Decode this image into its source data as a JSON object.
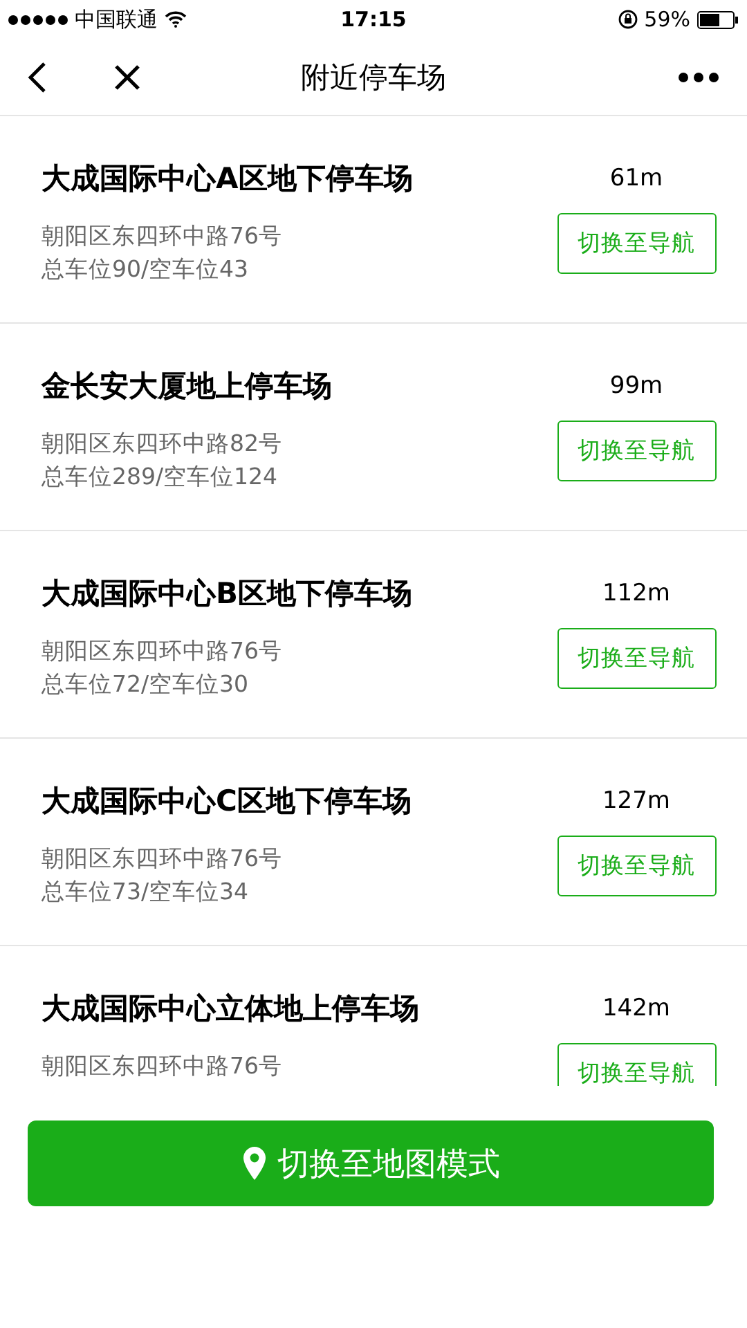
{
  "status_bar": {
    "carrier": "中国联通",
    "time": "17:15",
    "battery": "59%"
  },
  "nav": {
    "title": "附近停车场"
  },
  "parkings": [
    {
      "name": "大成国际中心A区地下停车场",
      "distance": "61m",
      "address": "朝阳区东四环中路76号",
      "spaces": "总车位90/空车位43",
      "button": "切换至导航"
    },
    {
      "name": "金长安大厦地上停车场",
      "distance": "99m",
      "address": "朝阳区东四环中路82号",
      "spaces": "总车位289/空车位124",
      "button": "切换至导航"
    },
    {
      "name": "大成国际中心B区地下停车场",
      "distance": "112m",
      "address": "朝阳区东四环中路76号",
      "spaces": "总车位72/空车位30",
      "button": "切换至导航"
    },
    {
      "name": "大成国际中心C区地下停车场",
      "distance": "127m",
      "address": "朝阳区东四环中路76号",
      "spaces": "总车位73/空车位34",
      "button": "切换至导航"
    },
    {
      "name": "大成国际中心立体地上停车场",
      "distance": "142m",
      "address": "朝阳区东四环中路76号",
      "button": "切换至导航"
    }
  ],
  "map_button": {
    "label": "切换至地图模式"
  }
}
